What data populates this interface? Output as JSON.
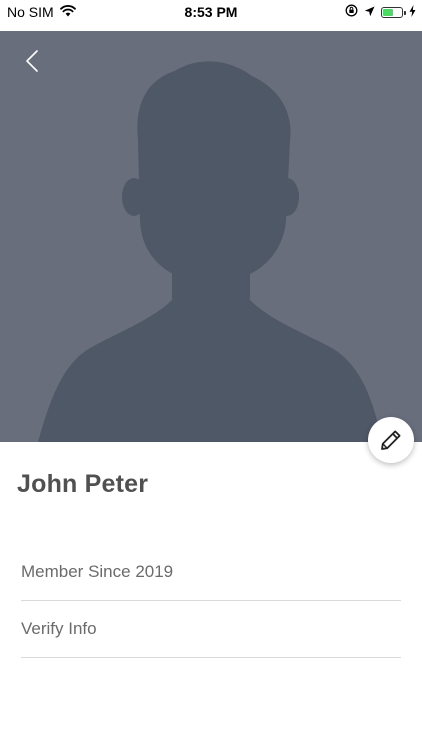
{
  "status_bar": {
    "carrier": "No SIM",
    "time": "8:53 PM",
    "battery_level": 0.55,
    "battery_color": "#4cd964"
  },
  "header": {
    "back_icon": "chevron-left-icon",
    "avatar_placeholder_icon": "person-silhouette-icon",
    "background_color": "#686e7c",
    "silhouette_color": "#4f5866"
  },
  "actions": {
    "edit_icon": "pencil-icon"
  },
  "profile": {
    "name": "John Peter"
  },
  "info_items": [
    {
      "label": "Member Since 2019"
    },
    {
      "label": "Verify Info"
    }
  ]
}
